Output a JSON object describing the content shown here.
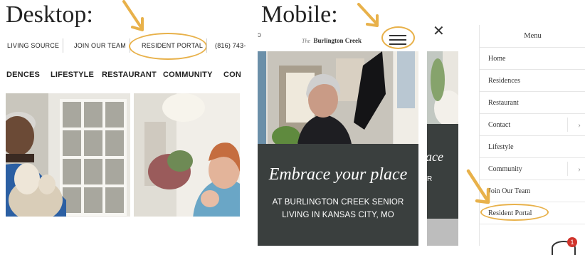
{
  "headings": {
    "desktop": "Desktop:",
    "mobile": "Mobile:"
  },
  "desktop": {
    "util_links": {
      "living_source": "LIVING SOURCE",
      "join_team": "JOIN OUR TEAM",
      "resident_portal": "RESIDENT PORTAL",
      "phone": "(816) 743-"
    },
    "nav": [
      "DENCES",
      "LIFESTYLE",
      "RESTAURANT",
      "COMMUNITY",
      "CON"
    ]
  },
  "mobile": {
    "brand": {
      "script": "The",
      "name": "Burlington Creek"
    },
    "banner_script": "Embrace your place",
    "banner_text_line1": "AT BURLINGTON CREEK SENIOR",
    "banner_text_line2": "LIVING IN KANSAS CITY, MO",
    "partial_script": "ace",
    "partial_text": "R",
    "menu": {
      "title": "Menu",
      "items": [
        {
          "label": "Home",
          "has_submenu": false
        },
        {
          "label": "Residences",
          "has_submenu": false
        },
        {
          "label": "Restaurant",
          "has_submenu": false
        },
        {
          "label": "Contact",
          "has_submenu": true
        },
        {
          "label": "Lifestyle",
          "has_submenu": false
        },
        {
          "label": "Community",
          "has_submenu": true
        },
        {
          "label": "Join Our Team",
          "has_submenu": false
        },
        {
          "label": "Resident Portal",
          "has_submenu": false
        }
      ]
    },
    "chat_badge_count": "1"
  },
  "colors": {
    "highlight": "#e8b14a",
    "banner": "#3a3f3e",
    "menu_border": "#e6e6e6",
    "badge": "#d0342c"
  },
  "icons": [
    "arrow-down-right-icon",
    "hamburger-menu-icon",
    "close-icon",
    "chevron-right-icon",
    "chat-icon"
  ]
}
